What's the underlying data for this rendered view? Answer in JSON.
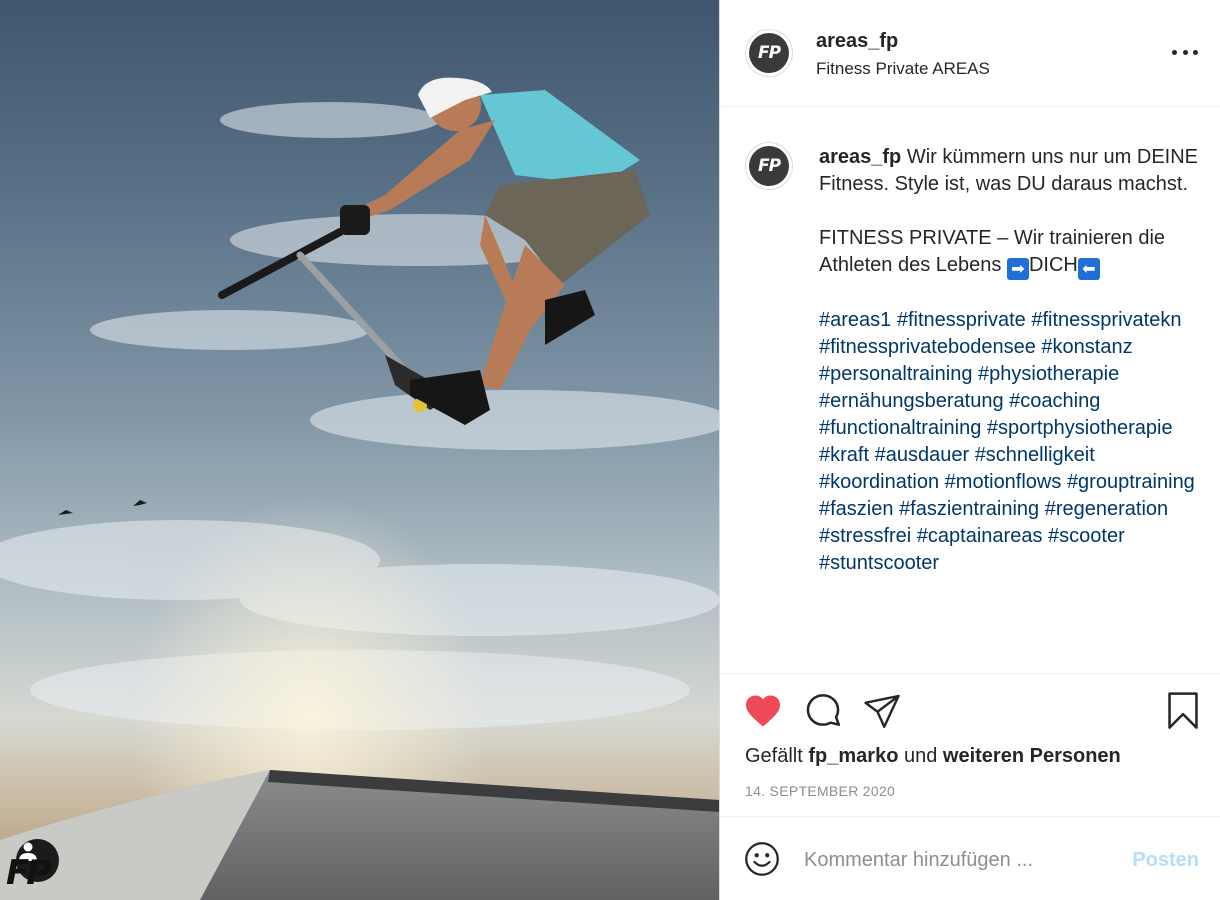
{
  "post": {
    "image_alt": "Scooter rider jumping in skatepark against sky",
    "watermark": "FP"
  },
  "header": {
    "avatar_initials": "FP",
    "username": "areas_fp",
    "subtitle": "Fitness Private AREAS"
  },
  "caption": {
    "avatar_initials": "FP",
    "username": "areas_fp",
    "text_line1": "Wir kümmern uns nur um DEINE Fitness. Style ist, was DU daraus machst.",
    "text_line2_pre": "FITNESS PRIVATE – Wir trainieren die Athleten des Lebens",
    "emoji_right": "➡",
    "text_line2_word": "DICH",
    "emoji_left": "⬅",
    "hashtags": [
      "#areas1",
      "#fitnessprivate",
      "#fitnessprivatekn",
      "#fitnessprivatebodensee",
      "#konstanz",
      "#personaltraining",
      "#physiotherapie",
      "#ernähungsberatung",
      "#coaching",
      "#functionaltraining",
      "#sportphysiotherapie",
      "#kraft",
      "#ausdauer",
      "#schnelligkeit",
      "#koordination",
      "#motionflows",
      "#grouptraining",
      "#faszien",
      "#faszientraining",
      "#regeneration",
      "#stressfrei",
      "#captainareas",
      "#scooter",
      "#stuntscooter"
    ]
  },
  "actions": {
    "like_icon": "heart-filled-icon",
    "comment_icon": "comment-icon",
    "share_icon": "send-icon",
    "save_icon": "bookmark-icon",
    "like_color": "#ed4956"
  },
  "likes": {
    "prefix": "Gefällt",
    "user": "fp_marko",
    "mid": "und",
    "others": "weiteren Personen"
  },
  "date": "14. SEPTEMBER 2020",
  "comment": {
    "emoji_icon": "smiley-icon",
    "placeholder": "Kommentar hinzufügen ...",
    "post_label": "Posten"
  }
}
